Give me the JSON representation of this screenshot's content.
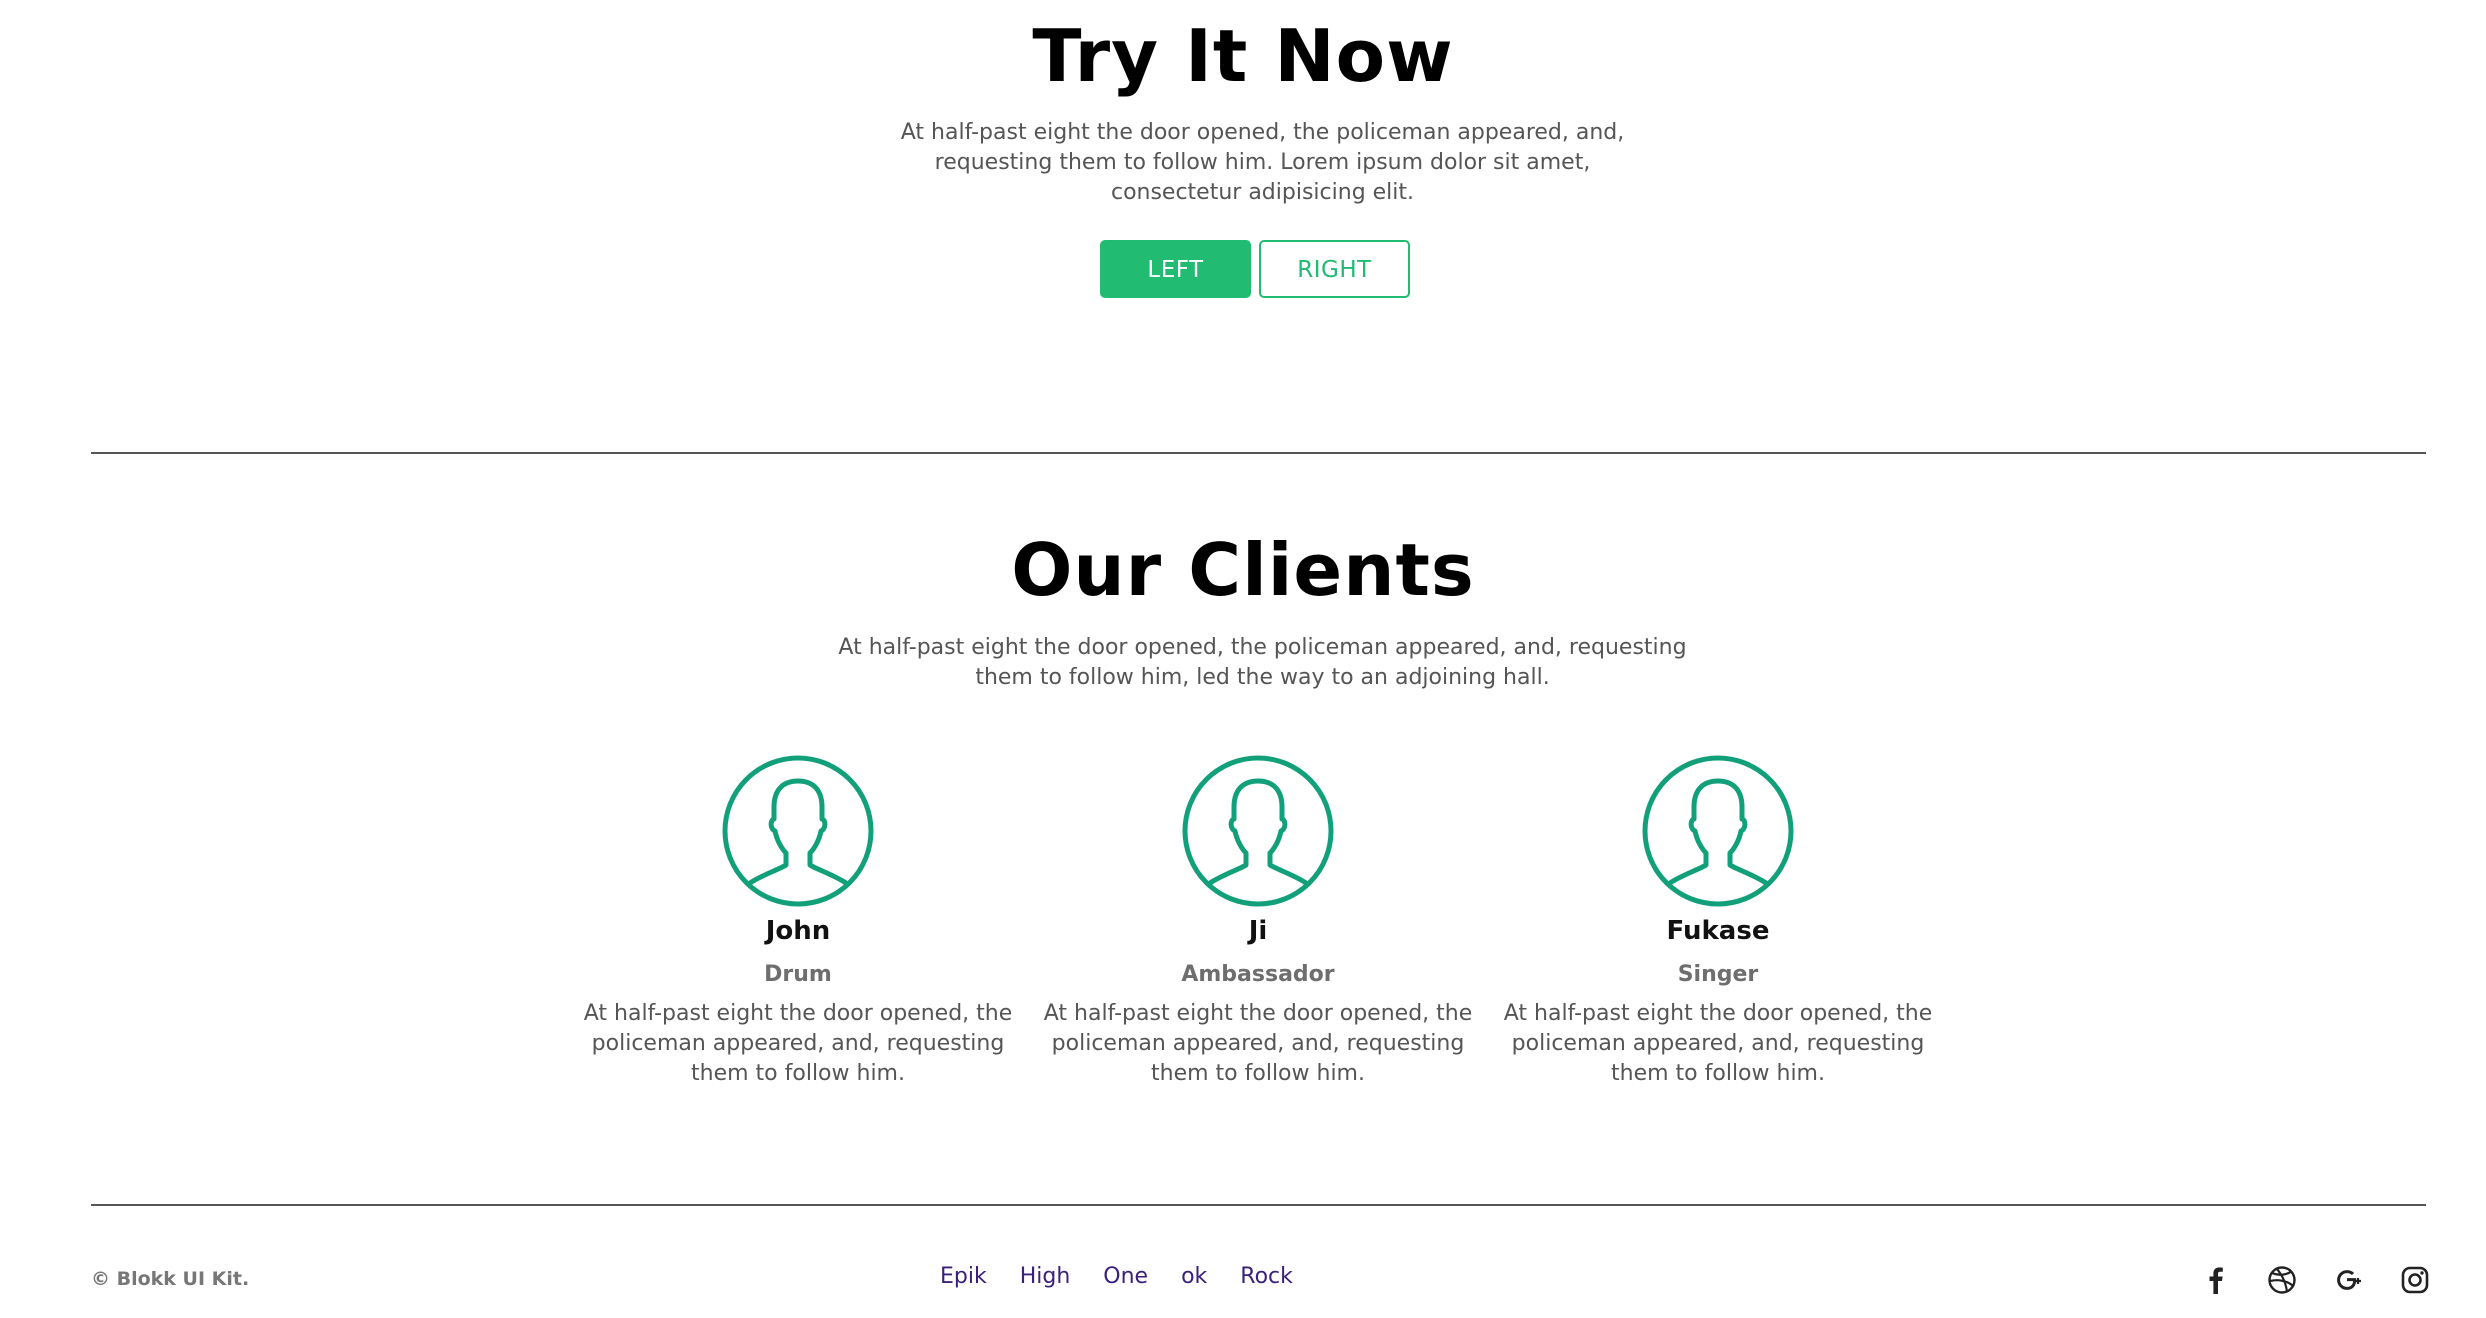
{
  "try_section": {
    "title": "Try It Now",
    "description": "At half-past eight the door opened, the policeman appeared, and, requesting them to follow him. Lorem ipsum dolor sit amet, consectetur adipisicing elit.",
    "left_button": "LEFT",
    "right_button": "RIGHT"
  },
  "clients_section": {
    "title": "Our Clients",
    "description": "At half-past eight the door opened, the policeman appeared, and, requesting them to follow him, led the way to an adjoining hall.",
    "clients": [
      {
        "name": "John",
        "role": "Drum",
        "text": "At half-past eight the door opened, the policeman appeared, and, requesting them to follow him."
      },
      {
        "name": "Ji",
        "role": "Ambassador",
        "text": "At half-past eight the door opened, the policeman appeared, and, requesting them to follow him."
      },
      {
        "name": "Fukase",
        "role": "Singer",
        "text": "At half-past eight the door opened, the policeman appeared, and, requesting them to follow him."
      }
    ]
  },
  "footer": {
    "copyright": "© Blokk UI Kit.",
    "links": [
      "Epik",
      "High",
      "One",
      "ok",
      "Rock"
    ],
    "social_icons": [
      "facebook-icon",
      "dribbble-icon",
      "google-plus-icon",
      "instagram-icon"
    ]
  },
  "colors": {
    "accent": "#22bb72",
    "avatar_stroke": "#12a07a",
    "link": "#3b1f7a",
    "divider": "#555555"
  }
}
